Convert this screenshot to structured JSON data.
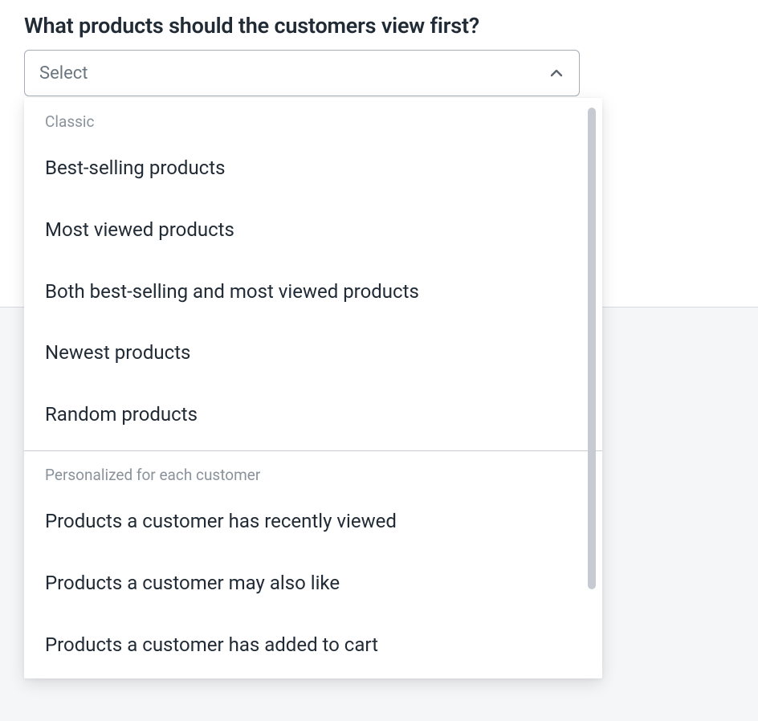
{
  "form": {
    "question": "What products should the customers view first?",
    "select": {
      "placeholder": "Select"
    }
  },
  "dropdown": {
    "groups": [
      {
        "label": "Classic",
        "options": [
          "Best-selling products",
          "Most viewed products",
          "Both best-selling and most viewed products",
          "Newest products",
          "Random products"
        ]
      },
      {
        "label": "Personalized for each customer",
        "options": [
          "Products a customer has recently viewed",
          "Products a customer may also like",
          "Products a customer has added to cart"
        ]
      }
    ]
  }
}
